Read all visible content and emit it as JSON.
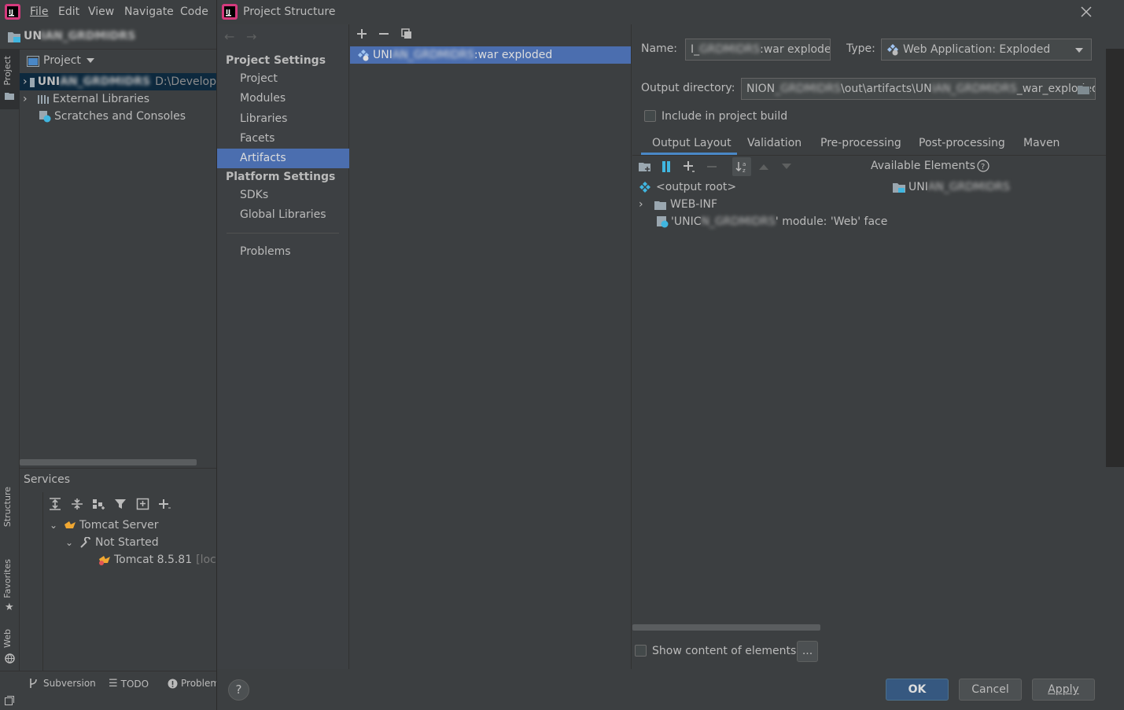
{
  "menu": {
    "file": "File",
    "edit": "Edit",
    "view": "View",
    "navigate": "Navigate",
    "code": "Code"
  },
  "ide": {
    "project_name": "UN",
    "project_name_blurred": "IAN_GRDMIDRS"
  },
  "left_tabs": {
    "project": "Project",
    "structure": "Structure",
    "favorites": "Favorites",
    "web": "Web"
  },
  "project_panel": {
    "dropdown_label": "Project",
    "root_name": "UNI",
    "root_name_blurred": "AN_GRDMIDRS",
    "root_path": "D:\\Develop",
    "external_libraries": "External Libraries",
    "scratches": "Scratches and Consoles"
  },
  "services": {
    "title": "Services",
    "tomcat_server": "Tomcat Server",
    "not_started": "Not Started",
    "tomcat_instance": "Tomcat 8.5.81",
    "tomcat_instance_suffix": "[local"
  },
  "bottom_tabs": {
    "subversion": "Subversion",
    "todo": "TODO",
    "problems": "Problem"
  },
  "dialog": {
    "title": "Project Structure",
    "nav": {
      "project_settings": "Project Settings",
      "project": "Project",
      "modules": "Modules",
      "libraries": "Libraries",
      "facets": "Facets",
      "artifacts": "Artifacts",
      "platform_settings": "Platform Settings",
      "sdks": "SDKs",
      "global_libraries": "Global Libraries",
      "problems": "Problems"
    },
    "artifact_item": {
      "prefix": "UNI",
      "blurred": "AN_GRDMIDRS",
      "suffix": ":war exploded"
    },
    "name_label": "Name:",
    "name_value": {
      "prefix": "I_",
      "blurred": "GRDMIDRS",
      "suffix": ":war exploded"
    },
    "type_label": "Type:",
    "type_value": "Web Application: Exploded",
    "output_dir_label": "Output directory:",
    "output_dir_value": {
      "prefix": "NION",
      "blurred1": "_GRDMIDRS",
      "mid": "\\out\\artifacts\\UN",
      "blurred2": "IAN_GRDMIDRS",
      "suffix": "_war_exploded"
    },
    "include_in_build": "Include in project build",
    "tabs": [
      "Output Layout",
      "Validation",
      "Pre-processing",
      "Post-processing",
      "Maven"
    ],
    "available_elements": "Available Elements",
    "available_item": {
      "prefix": "UNI",
      "blurred": "AN_GRDMIDRS"
    },
    "layout_tree": {
      "output_root": "<output root>",
      "web_inf": "WEB-INF",
      "facet": {
        "prefix": "'UNIC",
        "blurred": "N_GRDMIDRS",
        "suffix": "' module: 'Web' face"
      }
    },
    "show_content": "Show content of elements",
    "ellipsis": "...",
    "help": "?",
    "ok": "OK",
    "cancel": "Cancel",
    "apply": "Apply"
  },
  "colors": {
    "selection": "#4b6eaf",
    "nav_selection": "#4b6eaf",
    "ok_button": "#365880"
  }
}
